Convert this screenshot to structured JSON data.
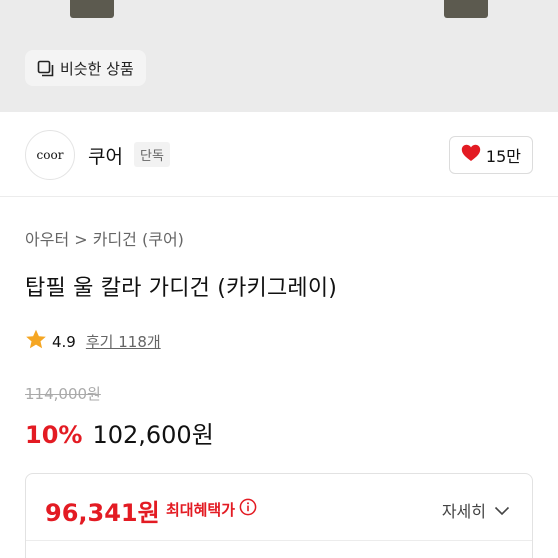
{
  "similar": {
    "label": "비슷한 상품",
    "icon": "copy-icon"
  },
  "brand": {
    "logo_text": "coor",
    "name": "쿠어",
    "badge": "단독"
  },
  "like": {
    "count": "15만",
    "icon": "heart-icon",
    "color": "#e31b23"
  },
  "breadcrumb": "아우터 > 카디건 (쿠어)",
  "product": {
    "title": "탑필 울 칼라 가디건 (카키그레이)"
  },
  "rating": {
    "score": "4.9",
    "reviews": "후기 118개",
    "star_color": "#f5a623"
  },
  "price": {
    "original": "114,000원",
    "discount": "10%",
    "sale": "102,600원"
  },
  "benefit": {
    "price": "96,341원",
    "label": "최대혜택가",
    "detail": "자세히",
    "accent": "#e31b23"
  }
}
